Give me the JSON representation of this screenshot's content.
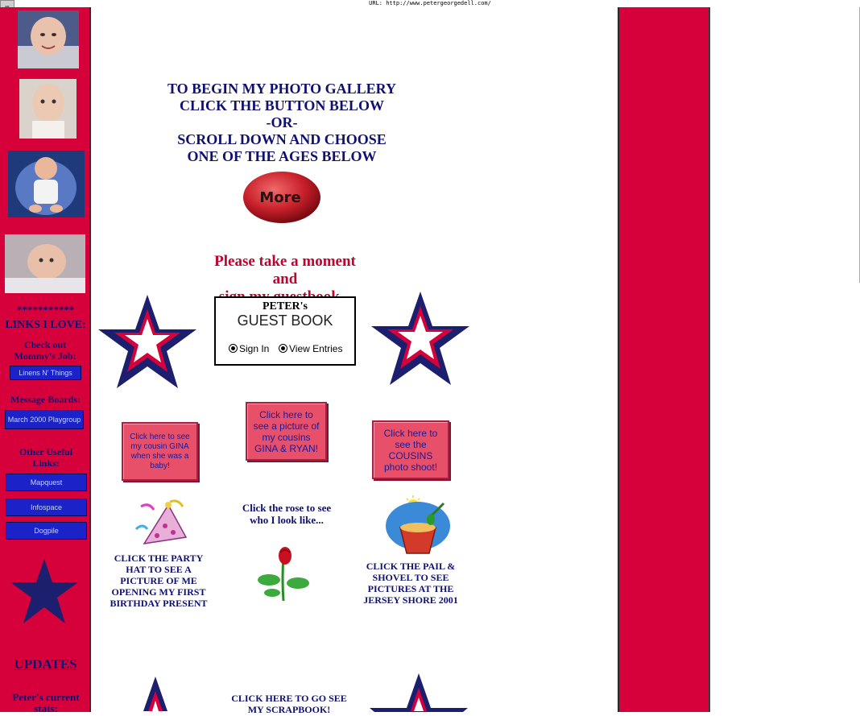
{
  "browser": {
    "url_text": "URL: http://www.petergeorgedell.com/"
  },
  "sidebar": {
    "asterisks": "***********",
    "links_heading": "LINKS I LOVE:",
    "mommy_job_label": "Check out Mommy's Job:",
    "mommy_job_link": "Linens N' Things",
    "message_boards_label": "Message Boards:",
    "message_board_link": "March 2000 Playgroup",
    "other_links_label": "Other Useful Links:",
    "other_links": [
      "Mapquest",
      "Infospace",
      "Dogpile"
    ],
    "updates_link": "UPDATES",
    "stats_label": "Peter's current stats:"
  },
  "main": {
    "gallery_heading": [
      "TO BEGIN MY PHOTO GALLERY",
      "CLICK THE BUTTON BELOW",
      "-OR-",
      "SCROLL DOWN AND CHOOSE",
      "ONE OF THE AGES BELOW"
    ],
    "more_button": "More",
    "guestbook_message": [
      "Please take a moment",
      "and",
      "sign my guestbook..."
    ],
    "guestbook": {
      "title": "PETER's",
      "subtitle": "GUEST BOOK",
      "option_sign": "Sign In",
      "option_view": "View Entries"
    },
    "buttons": {
      "gina_baby": "Click here to see my cousin GINA when she was a baby!",
      "gina_ryan": "Click here to see a picture of my cousins GINA & RYAN!",
      "cousins_shoot": "Click here to see the COUSINS photo shoot!"
    },
    "party_caption": "CLICK THE PARTY HAT TO SEE A PICTURE OF ME OPENING MY FIRST BIRTHDAY PRESENT",
    "rose_caption": "Click the rose to see who I look like...",
    "pail_caption": "CLICK THE PAIL & SHOVEL TO SEE PICTURES AT THE JERSEY SHORE 2001",
    "scrapbook_caption": "CLICK HERE TO GO SEE MY SCRAPBOOK!"
  },
  "colors": {
    "red": "#d6003a",
    "navy": "#101070",
    "star_navy": "#1c1f6e"
  },
  "icons": [
    "baby-photo",
    "star-icon",
    "party-hat-icon",
    "rose-icon",
    "pail-shovel-icon"
  ]
}
